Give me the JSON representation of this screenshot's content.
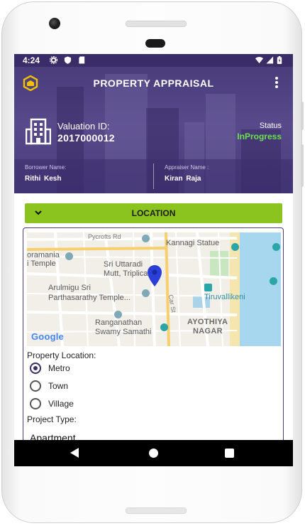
{
  "statusbar": {
    "time": "4:24"
  },
  "header": {
    "title": "PROPERTY APPRAISAL",
    "valuation_label": "Valuation ID:",
    "valuation_id": "2017000012",
    "status_label": "Status",
    "status_value": "InProgress",
    "borrower_label": "Borrower Name:",
    "borrower_name": "Rithi  Kesh",
    "appraiser_label": "Appraiser Name :",
    "appraiser_name": "Kiran  Raja"
  },
  "location_section": {
    "title": "LOCATION"
  },
  "map": {
    "labels": {
      "pycrofts": "Pycrofts Rd",
      "kannagi": "Kannagi Statue",
      "oramania": "oramania",
      "temple_left": "i Temple",
      "uttaradi1": "Sri Uttaradi",
      "uttaradi2": "Mutt, Triplicane",
      "arulmigu1": "Arulmigu Sri",
      "arulmigu2": "Parthasarathy Temple...",
      "car_st": "Car St",
      "tiruvallikeni": "Tiruvallikeni",
      "ranganathan1": "Ranganathan",
      "ranganathan2": "Swamy Samathi",
      "ayothiya1": "AYOTHIYA",
      "ayothiya2": "NAGAR",
      "google": "Google"
    }
  },
  "form": {
    "property_location_label": "Property Location:",
    "location_options": [
      {
        "label": "Metro",
        "checked": true
      },
      {
        "label": "Town",
        "checked": false
      },
      {
        "label": "Village",
        "checked": false
      }
    ],
    "project_type_label": "Project Type:",
    "project_type_value": "Apartment"
  },
  "colors": {
    "header_purple": "#4a3d7c",
    "status_green": "#6ce052",
    "location_bar_green": "#8cc41f",
    "map_water": "#a7d7ef",
    "map_park": "#c8e6c0"
  }
}
